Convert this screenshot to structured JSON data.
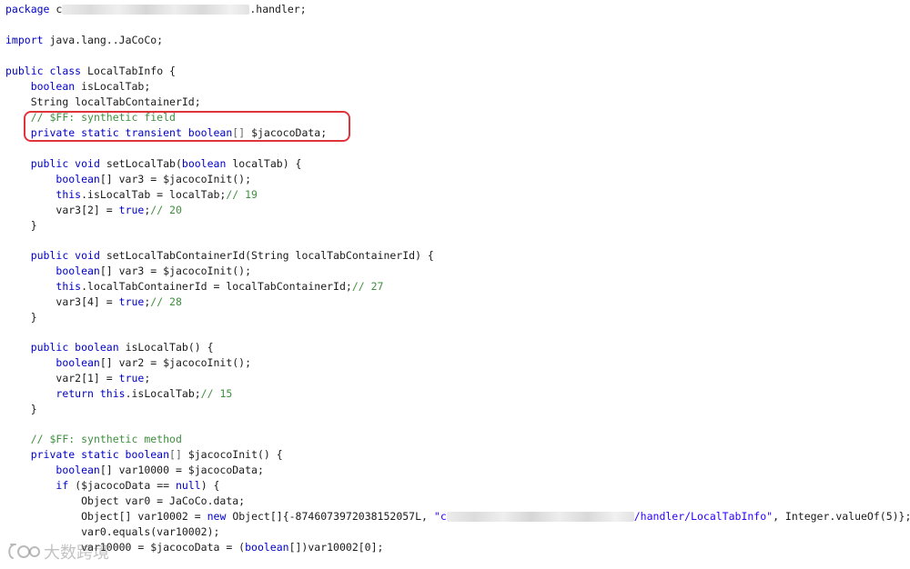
{
  "code": {
    "package_kw": "package",
    "package_prefix": "c",
    "package_suffix": ".handler;",
    "import_kw": "import",
    "import_name": "java.lang..JaCoCo;",
    "class_kw1": "public",
    "class_kw2": "class",
    "class_name": "LocalTabInfo {",
    "f1_type": "boolean",
    "f1_name": "isLocalTab;",
    "f2_type": "String",
    "f2_name": "localTabContainerId;",
    "c1": "// $FF: synthetic field",
    "f3_mods": "private static transient boolean",
    "f3_arr": "[]",
    "f3_name": "$jacocoData;",
    "m1_mods": "public void",
    "m1_name": "setLocalTab(",
    "m1_ptype": "boolean",
    "m1_pname": "localTab) {",
    "m1_l1_type": "boolean",
    "m1_l1_rest": "[] var3 = $jacocoInit();",
    "m1_l2_this": "this",
    "m1_l2_rest": ".isLocalTab = localTab;",
    "m1_l2_cm": "// 19",
    "m1_l3_a": "var3[2] =",
    "m1_l3_kw": "true",
    "m1_l3_b": ";",
    "m1_l3_cm": "// 20",
    "close": "}",
    "m2_mods": "public void",
    "m2_name": "setLocalTabContainerId(String localTabContainerId) {",
    "m2_l1_type": "boolean",
    "m2_l1_rest": "[] var3 = $jacocoInit();",
    "m2_l2_this": "this",
    "m2_l2_rest": ".localTabContainerId = localTabContainerId;",
    "m2_l2_cm": "// 27",
    "m2_l3_a": "var3[4] =",
    "m2_l3_kw": "true",
    "m2_l3_b": ";",
    "m2_l3_cm": "// 28",
    "m3_mods": "public boolean",
    "m3_name": "isLocalTab() {",
    "m3_l1_type": "boolean",
    "m3_l1_rest": "[] var2 = $jacocoInit();",
    "m3_l2_a": "var2[1] =",
    "m3_l2_kw": "true",
    "m3_l2_b": ";",
    "m3_l3_kw": "return",
    "m3_l3_this": "this",
    "m3_l3_rest": ".isLocalTab;",
    "m3_l3_cm": "// 15",
    "c2": "// $FF: synthetic method",
    "m4_mods": "private static boolean",
    "m4_arr": "[]",
    "m4_name": "$jacocoInit() {",
    "m4_l1_type": "boolean",
    "m4_l1_rest": "[] var10000 = $jacocoData;",
    "m4_l2_kw": "if",
    "m4_l2_a": "($jacocoData ==",
    "m4_l2_null": "null",
    "m4_l2_b": ") {",
    "m4_l3": "Object var0 = JaCoCo.data;",
    "m4_l4_a": "Object[] var10002 =",
    "m4_l4_new": "new",
    "m4_l4_b": "Object[]{-8746073972038152057L,",
    "m4_l4_str_start": "\"c",
    "m4_l4_str_end": "/handler/LocalTabInfo\"",
    "m4_l4_c": ", Integer.valueOf(5)};",
    "m4_l5": "var0.equals(var10002);",
    "m4_l6_a": "var10000 = $jacocoData = (",
    "m4_l6_type": "boolean",
    "m4_l6_b": "[])var10002[0];"
  },
  "watermark": {
    "text": "大数跨境"
  }
}
